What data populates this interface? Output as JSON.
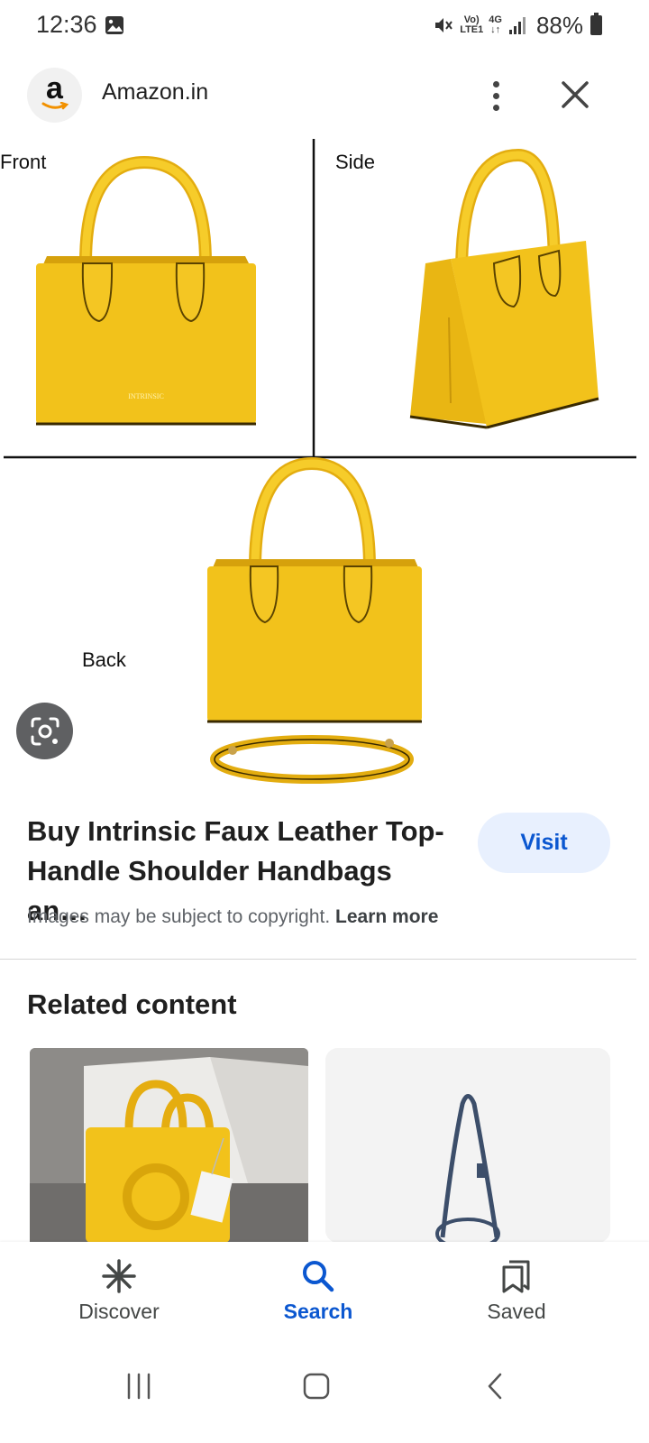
{
  "status_bar": {
    "time": "12:36",
    "signal_labels": [
      "Vo)",
      "LTE1",
      "4G",
      "↓↑"
    ],
    "battery": "88%"
  },
  "header": {
    "site_logo_letter": "a",
    "site_name": "Amazon.in"
  },
  "product_image": {
    "label_front": "Front",
    "label_side": "Side",
    "label_back": "Back",
    "bag_color": "#f2c21b"
  },
  "result": {
    "title": "Buy Intrinsic Faux Leather Top-Handle Shoulder Handbags an…",
    "visit_label": "Visit",
    "copyright_text": "Images may be subject to copyright.",
    "learn_more": "Learn more"
  },
  "related": {
    "heading": "Related content"
  },
  "bottom_nav": {
    "items": [
      {
        "label": "Discover",
        "icon": "asterisk-icon"
      },
      {
        "label": "Search",
        "icon": "search-icon"
      },
      {
        "label": "Saved",
        "icon": "bookmarks-icon"
      }
    ],
    "active_color": "#0b57d0"
  },
  "system_nav": {
    "icons": [
      "recent-apps-icon",
      "home-icon",
      "back-icon"
    ]
  }
}
